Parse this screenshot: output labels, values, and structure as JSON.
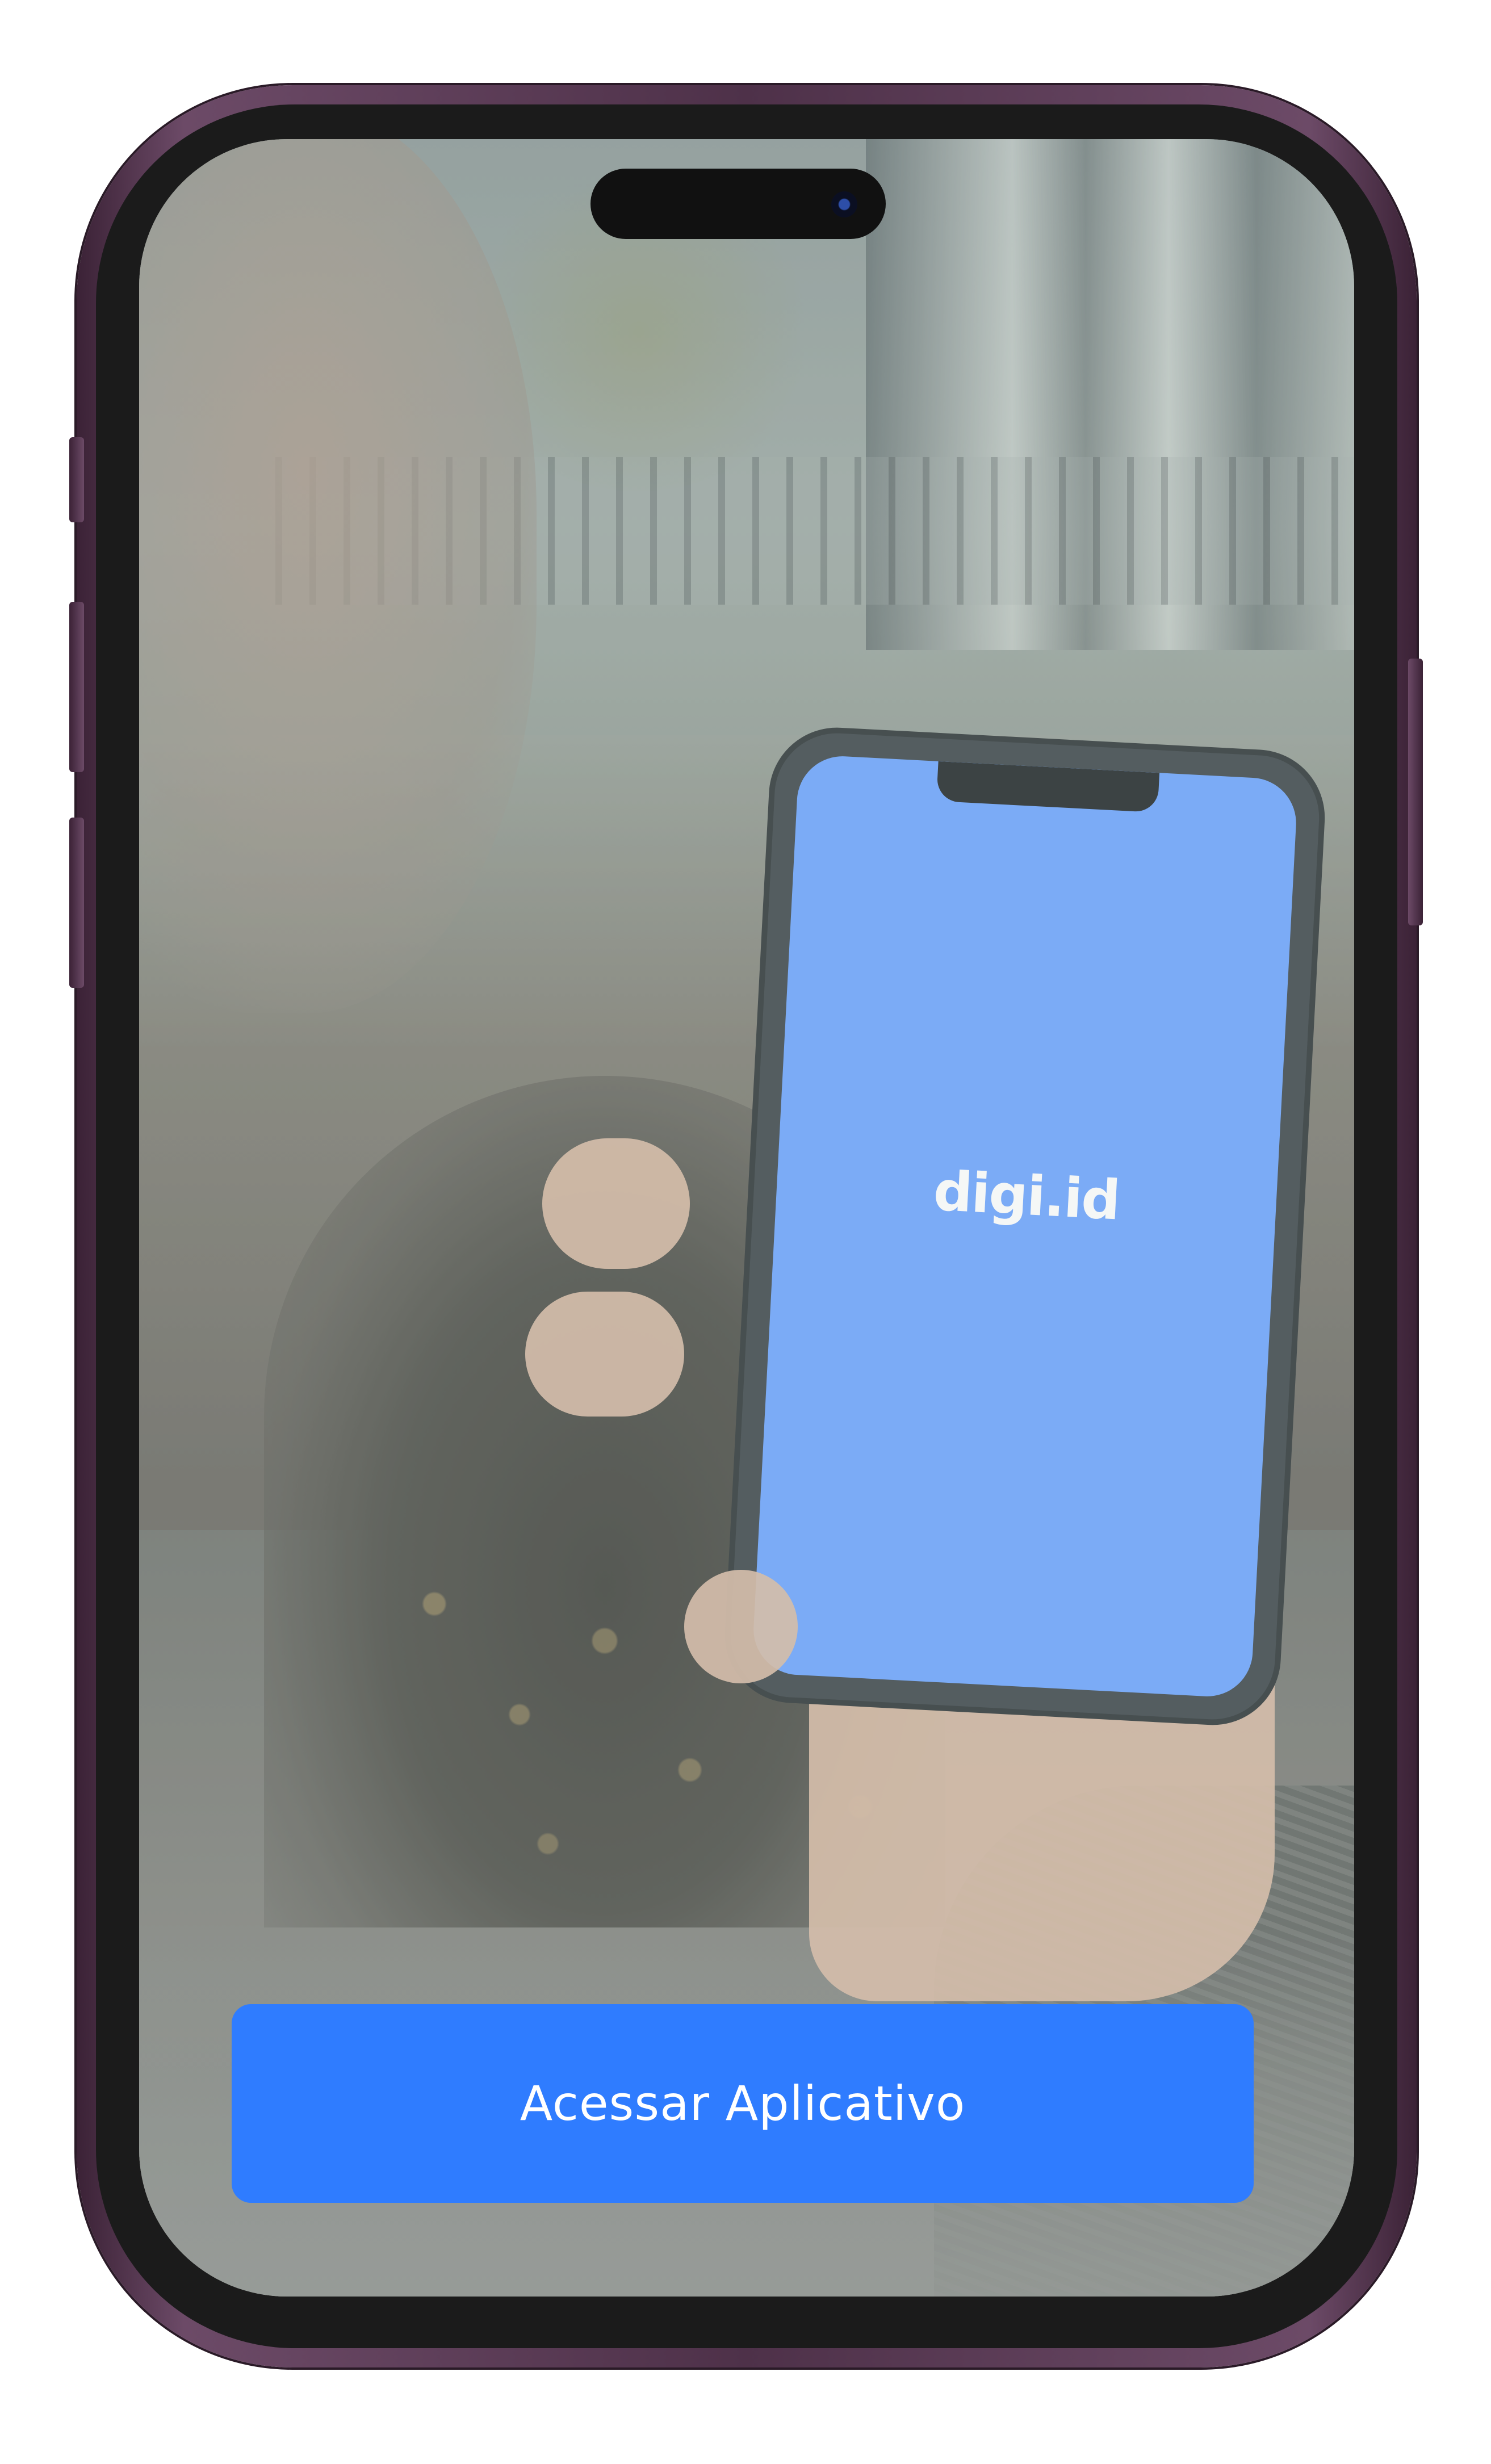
{
  "app": {
    "logo_text": "digi.id"
  },
  "actions": {
    "primary_label": "Acessar Aplicativo"
  },
  "colors": {
    "accent": "#2f7cff",
    "splash_blue": "#6ba3ff",
    "device_frame": "#5a3b55"
  },
  "icons": {
    "camera": "front-camera-icon"
  }
}
